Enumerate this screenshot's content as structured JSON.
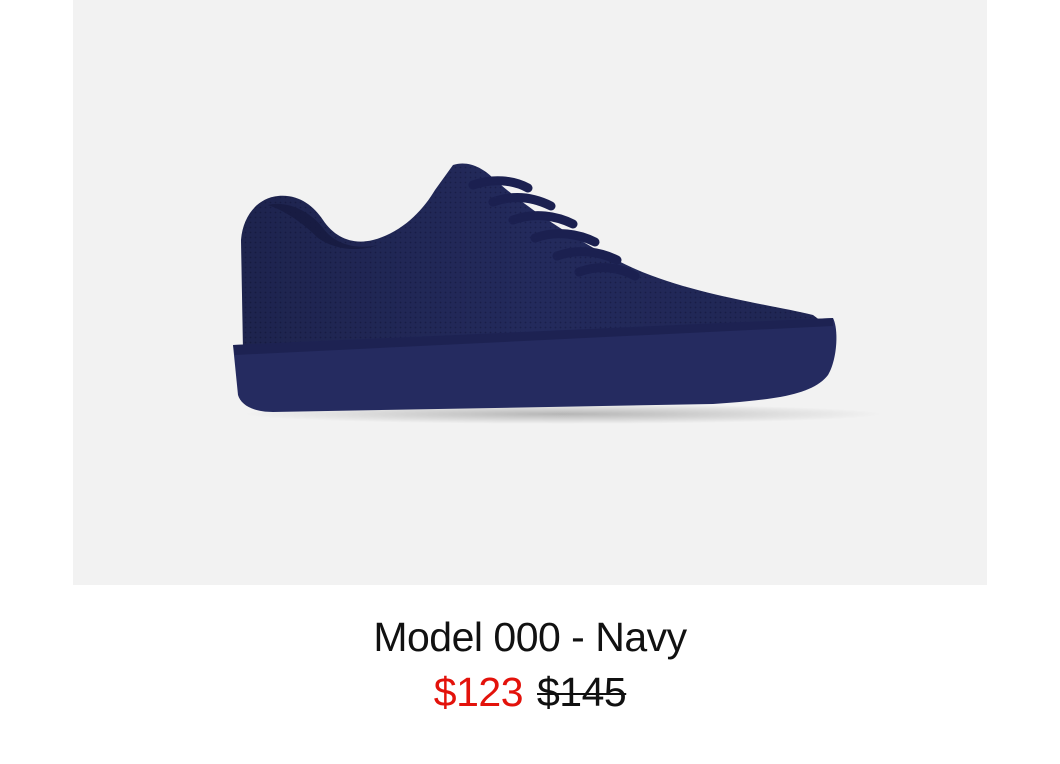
{
  "product": {
    "title": "Model 000 - Navy",
    "sale_price": "$123",
    "original_price": "$145",
    "image_alt": "Navy knit low-top sneaker",
    "shoe_color": "#1f2456",
    "sale_color": "#e3120b",
    "background_color": "#f2f2f2"
  }
}
